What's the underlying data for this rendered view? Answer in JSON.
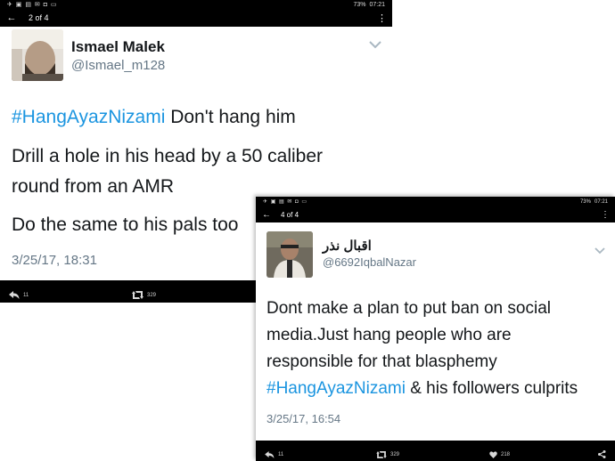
{
  "screenshot1": {
    "status": {
      "left_icons": "✈ ▣ ▤ ✉ ◘ ▭",
      "signal": "73%",
      "time": "07:21"
    },
    "nav": {
      "back": "←",
      "counter": "2 of 4",
      "menu": "⋮"
    },
    "author": {
      "name": "Ismael Malek",
      "handle": "@Ismael_m128"
    },
    "tweet": {
      "hashtag": "#HangAyazNizami",
      "line1_rest": " Don't hang him",
      "line2": "Drill a hole in his head by a 50 caliber",
      "line3": "round from an AMR",
      "line4": "Do the same to his pals too"
    },
    "timestamp": "3/25/17, 18:31",
    "actions": {
      "reply_count": "11",
      "retweet_count": "329"
    }
  },
  "screenshot2": {
    "status": {
      "left_icons": "✈ ▣ ▤ ✉ ◘ ▭",
      "signal": "73%",
      "time": "07:21"
    },
    "nav": {
      "back": "←",
      "counter": "4 of 4",
      "menu": "⋮"
    },
    "author": {
      "name": "اقبال نذر",
      "handle": "@6692IqbalNazar"
    },
    "tweet": {
      "line1": "Dont make a plan to put ban on social",
      "line2": "media.Just hang people who are",
      "line3": "responsible for that blasphemy",
      "hashtag": "#HangAyazNizami",
      "line4_rest": " & his followers culprits"
    },
    "timestamp": "3/25/17, 16:54",
    "actions": {
      "reply_count": "11",
      "retweet_count": "329",
      "like_count": "218"
    }
  },
  "colors": {
    "hashtag": "#1b95e0",
    "text": "#14171a",
    "secondary": "#657786",
    "bar": "#000000"
  },
  "icons": [
    "back-arrow-icon",
    "overflow-menu-icon",
    "reply-icon",
    "retweet-icon",
    "heart-icon",
    "share-icon",
    "chevron-down-icon"
  ]
}
